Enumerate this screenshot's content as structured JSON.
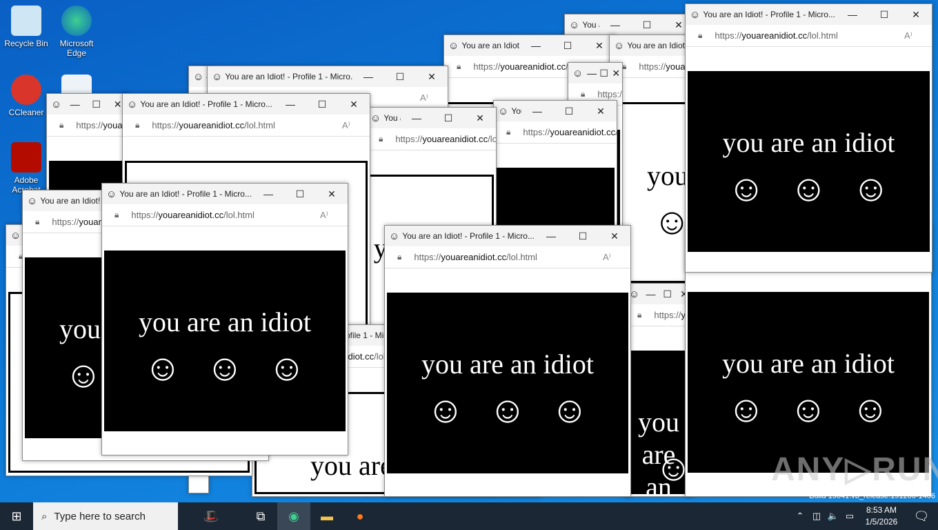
{
  "desktop": {
    "icons": [
      {
        "label": "Recycle Bin"
      },
      {
        "label": "Microsoft Edge"
      },
      {
        "label": "CCleaner"
      },
      {
        "label": ""
      },
      {
        "label": "Adobe Acrobat"
      }
    ]
  },
  "window": {
    "title": "You are an Idiot! - Profile 1 - Micro...",
    "url_prefix": "https://",
    "url_domain": "youareanidiot.cc",
    "url_path": "/lol.html",
    "caption": "you are an idiot",
    "smiley": "☺",
    "minimize": "—",
    "maximize": "☐",
    "close": "✕",
    "read_aloud": "A⁾"
  },
  "taskbar": {
    "search_placeholder": "Type here to search",
    "time": "8:53 AM",
    "date": "1/5/2026"
  },
  "watermark": {
    "text": "ANY ▷ RUN",
    "build": "Build 19041.vb_release.191206-1406"
  }
}
